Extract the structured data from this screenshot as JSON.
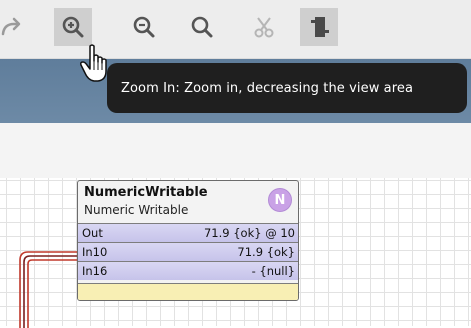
{
  "toolbar": {
    "buttons": [
      {
        "name": "redo",
        "icon": "redo-icon"
      },
      {
        "name": "zoom-in",
        "icon": "zoom-in-icon",
        "state": "hovered"
      },
      {
        "name": "zoom-out",
        "icon": "zoom-out-icon"
      },
      {
        "name": "zoom-fit",
        "icon": "search-icon"
      },
      {
        "name": "delete",
        "icon": "scissors-icon"
      },
      {
        "name": "toggle-palette",
        "icon": "palette-toggle-icon",
        "state": "active"
      }
    ]
  },
  "tooltip": {
    "text": "Zoom In: Zoom in, decreasing the view area"
  },
  "node": {
    "title": "NumericWritable",
    "subtitle": "Numeric Writable",
    "badge": "N",
    "badge_color": "#c9a2e6",
    "slots": [
      {
        "name": "Out",
        "value": "71.9 {ok} @ 10"
      },
      {
        "name": "In10",
        "value": "71.9 {ok}"
      },
      {
        "name": "In16",
        "value": "- {null}"
      }
    ]
  },
  "colors": {
    "header_band": "#6d8aa6",
    "wire": "#c0392b",
    "slot_fill": "#c6c3ea",
    "footer_fill": "#f8efb4"
  }
}
